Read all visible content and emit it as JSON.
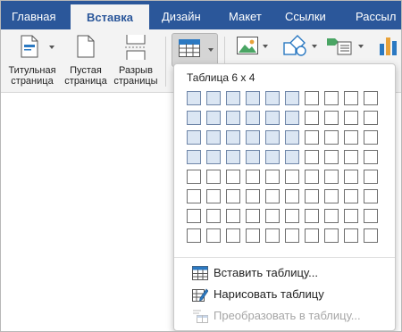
{
  "tabs": [
    {
      "label": "Главная",
      "active": false
    },
    {
      "label": "Вставка",
      "active": true
    },
    {
      "label": "Дизайн",
      "active": false
    },
    {
      "label": "Макет",
      "active": false
    },
    {
      "label": "Ссылки",
      "active": false
    },
    {
      "label": "Рассыл",
      "active": false
    }
  ],
  "ribbon": {
    "cover_page": {
      "line1": "Титульная",
      "line2": "страница",
      "icon": "cover-page-icon"
    },
    "blank_page": {
      "line1": "Пустая",
      "line2": "страница",
      "icon": "blank-page-icon"
    },
    "page_break": {
      "line1": "Разрыв",
      "line2": "страницы",
      "icon": "page-break-icon"
    },
    "table": {
      "icon": "table-icon"
    },
    "picture": {
      "icon": "picture-icon"
    },
    "shapes": {
      "icon": "shapes-icon"
    },
    "smartart": {
      "icon": "smartart-icon"
    },
    "chart": {
      "icon": "chart-icon"
    }
  },
  "table_menu": {
    "title": "Таблица 6 x 4",
    "grid": {
      "columns": 10,
      "rows": 8,
      "selected_columns": 6,
      "selected_rows": 4
    },
    "items": [
      {
        "label": "Вставить таблицу...",
        "icon": "insert-table-icon",
        "enabled": true
      },
      {
        "label": "Нарисовать таблицу",
        "icon": "draw-table-icon",
        "enabled": true
      },
      {
        "label": "Преобразовать в таблицу...",
        "icon": "convert-table-icon",
        "enabled": false
      }
    ]
  },
  "colors": {
    "tabbar": "#2b579a",
    "ribbon": "#f3f3f3",
    "grid_selected": "#dbe6f3"
  }
}
